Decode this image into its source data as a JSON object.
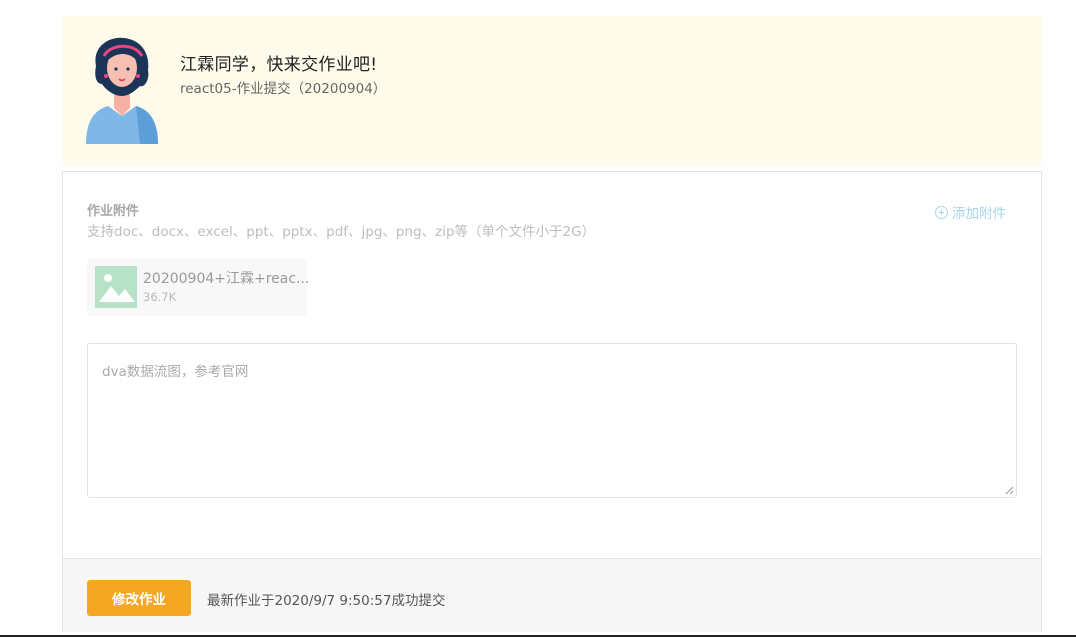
{
  "header": {
    "greeting": "江霖同学，快来交作业吧!",
    "assignment": "react05-作业提交（20200904）"
  },
  "attachments": {
    "title": "作业附件",
    "hint": "支持doc、docx、excel、ppt、pptx、pdf、jpg、png、zip等（单个文件小于2G）",
    "add_label": "添加附件",
    "add_icon": "plus-circle-icon",
    "files": [
      {
        "name": "20200904+江霖+reac...",
        "size": "36.7K",
        "icon": "image-icon"
      }
    ]
  },
  "content": {
    "text": "dva数据流图，参考官网"
  },
  "footer": {
    "button_label": "修改作业",
    "status": "最新作业于2020/9/7 9:50:57成功提交"
  },
  "colors": {
    "banner_bg": "#fffbea",
    "accent": "#f5a623",
    "link": "#a8d4ea"
  }
}
